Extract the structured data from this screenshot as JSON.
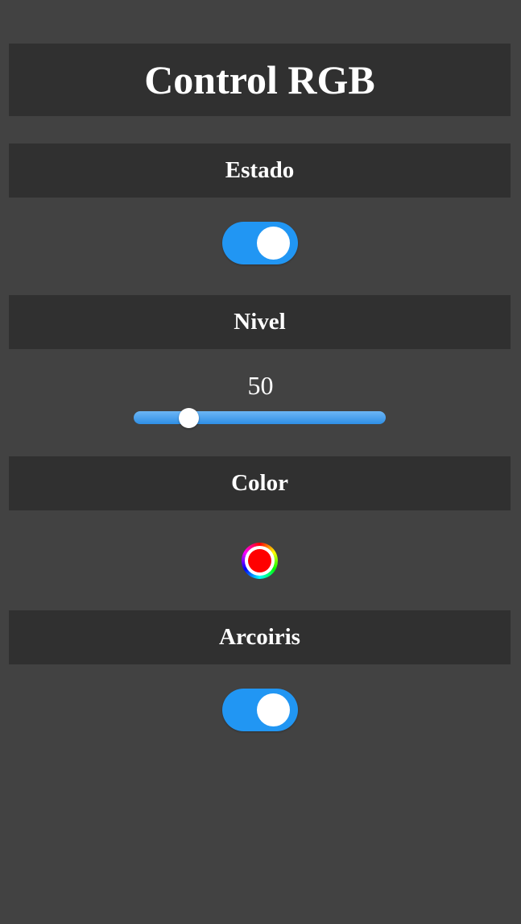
{
  "app": {
    "title": "Control RGB"
  },
  "sections": {
    "estado": {
      "label": "Estado",
      "toggle_on": true
    },
    "nivel": {
      "label": "Nivel",
      "value": "50",
      "slider_fraction": 0.22
    },
    "color": {
      "label": "Color",
      "selected_color": "#ff0000"
    },
    "arcoiris": {
      "label": "Arcoiris",
      "toggle_on": true
    }
  },
  "colors": {
    "background": "#424242",
    "panel": "#303030",
    "accent": "#2196f3",
    "text": "#ffffff"
  },
  "icons": {
    "color_picker": "color-wheel-icon"
  }
}
